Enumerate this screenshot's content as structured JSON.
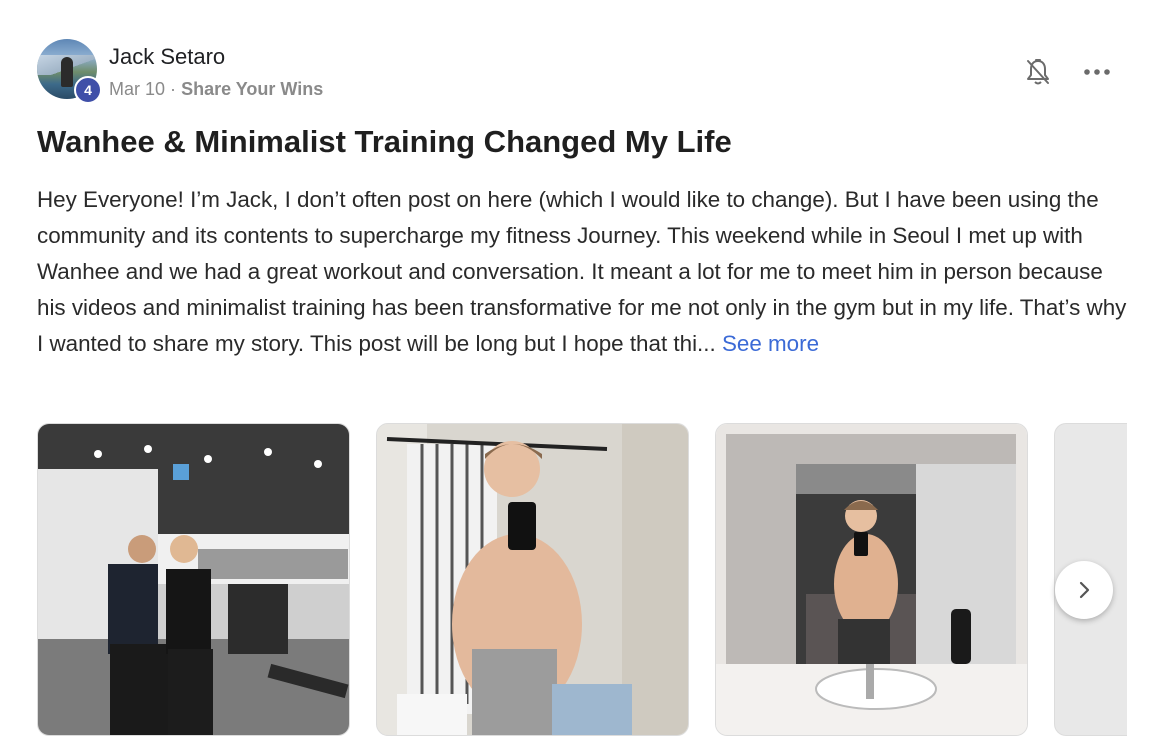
{
  "post": {
    "author": "Jack Setaro",
    "level": "4",
    "date": "Mar 10",
    "separator": "·",
    "category": "Share Your Wins",
    "title": "Wanhee & Minimalist Training Changed My Life",
    "body": "Hey Everyone! I’m Jack, I don’t often post on here (which I would like to change). But I have been using the community and its contents to supercharge my fitness Journey. This weekend while in Seoul I met up with Wanhee and we had a great workout and conversation. It meant a lot for me to meet him in person because his videos and minimalist training has been transformative for me not only in the gym but in my life. That’s why I wanted to share my story. This post will be long but I hope that thi...",
    "see_more": "See more"
  },
  "icons": {
    "notifications": "bell-off-icon",
    "menu": "more-horizontal-icon",
    "next": "chevron-right-icon"
  },
  "colors": {
    "badge": "#3f4fa8",
    "link": "#3b6ad6",
    "meta": "#8a8a8a"
  }
}
